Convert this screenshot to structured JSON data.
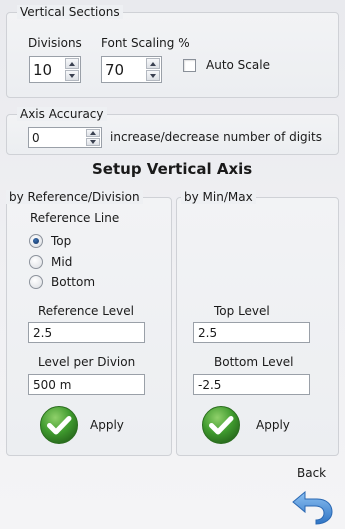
{
  "vertical_sections": {
    "title": "Vertical Sections",
    "divisions_label": "Divisions",
    "divisions_value": "10",
    "font_scaling_label": "Font Scaling %",
    "font_scaling_value": "70",
    "auto_scale_label": "Auto Scale",
    "auto_scale_checked": false
  },
  "axis_accuracy": {
    "title": "Axis Accuracy",
    "value": "0",
    "hint": "increase/decrease number of digits"
  },
  "setup_title": "Setup Vertical Axis",
  "by_reference": {
    "title": "by Reference/Division",
    "reference_line_label": "Reference Line",
    "options": [
      "Top",
      "Mid",
      "Bottom"
    ],
    "selected": "Top",
    "reference_level_label": "Reference Level",
    "reference_level_value": "2.5",
    "level_per_division_label": "Level per Divion",
    "level_per_division_value": "500 m",
    "apply_label": "Apply"
  },
  "by_minmax": {
    "title": "by Min/Max",
    "top_level_label": "Top Level",
    "top_level_value": "2.5",
    "bottom_level_label": "Bottom Level",
    "bottom_level_value": "-2.5",
    "apply_label": "Apply"
  },
  "back_label": "Back",
  "colors": {
    "apply_green": "#3f9a2e",
    "back_blue": "#3f86d4"
  }
}
